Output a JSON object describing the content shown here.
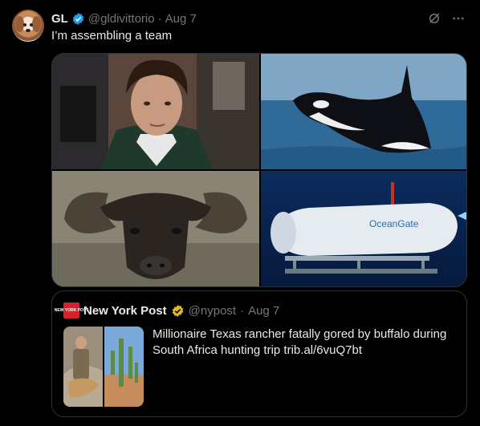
{
  "tweet": {
    "author_name": "GL",
    "author_handle": "@gldivittorio",
    "separator": "·",
    "date": "Aug 7",
    "text": "I’m assembling a team",
    "icons": [
      "grok-icon",
      "more-icon",
      "verified-badge-icon"
    ],
    "media": [
      {
        "name": "media-image-man-in-court"
      },
      {
        "name": "media-image-orca"
      },
      {
        "name": "media-image-buffalo"
      },
      {
        "name": "media-image-submersible"
      }
    ],
    "submersible_logo_text": "OceanGate"
  },
  "quote": {
    "author_name": "New York Post",
    "logo_text": "NEW YORK POST",
    "author_handle": "@nypost",
    "separator": "·",
    "date": "Aug 7",
    "text": "Millionaire Texas rancher fatally gored by buffalo during South Africa hunting trip trib.al/6vuQ7bt"
  },
  "colors": {
    "background": "#000000",
    "text": "#e7e9ea",
    "secondary_text": "#71767b",
    "border": "#2f3336",
    "verified_blue": "#1d9bf0",
    "verified_gold": "#e2b719",
    "nypost_red": "#d4232a"
  }
}
